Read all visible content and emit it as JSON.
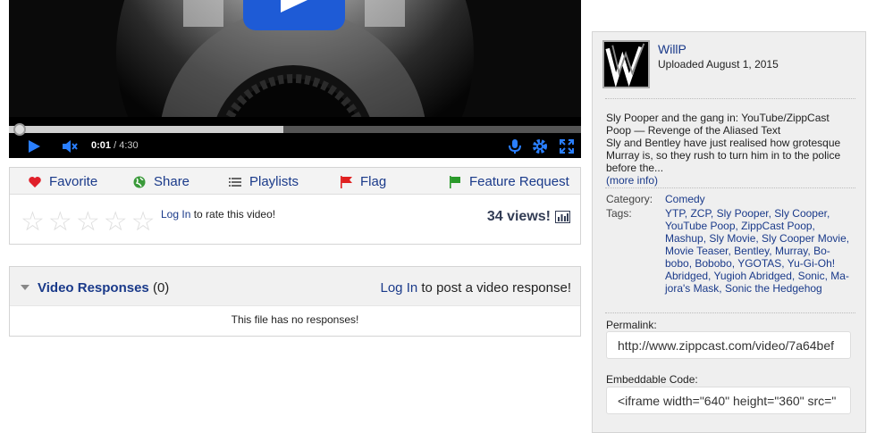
{
  "player": {
    "current_time": "0:01",
    "duration": "4:30",
    "progress_buffered": 0.48,
    "progress_played": 0.004
  },
  "actions": {
    "favorite": "Favorite",
    "share": "Share",
    "playlists": "Playlists",
    "flag": "Flag",
    "feature_request": "Feature Request"
  },
  "rating": {
    "stars": 5,
    "filled": 0,
    "login_link": "Log In",
    "login_suffix": " to rate this video!",
    "views": "34 views!"
  },
  "responses": {
    "title": "Video Responses",
    "count": "(0)",
    "login_link": "Log In",
    "login_suffix": " to post a video response!",
    "empty": "This file has no responses!"
  },
  "uploader": {
    "name": "WillP",
    "uploaded": "Uploaded August 1, 2015"
  },
  "description": {
    "line1": "Sly Pooper and the gang in: YouTube/ZippCast Poop — Revenge of the Aliased Text",
    "line2": "Sly and Bentley have just realised how grotesque Murray is, so they rush to turn him in to the police before the...",
    "more": "(more info)"
  },
  "meta": {
    "category_label": "Category:",
    "category": "Comedy",
    "tags_label": "Tags:",
    "tags": "YTP, ZCP, Sly Pooper, Sly Cooper, YouTube Poop, ZippCast Poop, Mashup, Sly Movie, Sly Cooper Movie, Movie Teaser, Bentley, Murray, Bo-bobo, Bobobo, YGOTAS, Yu-Gi-Oh! Abridged, Yugioh Abridged, Sonic, Ma-jora's Mask, Sonic the Hedgehog"
  },
  "share_fields": {
    "permalink_label": "Permalink:",
    "permalink": "http://www.zippcast.com/video/7a64bef",
    "embed_label": "Embeddable Code:",
    "embed": "<iframe width=\"640\" height=\"360\" src=\""
  },
  "colors": {
    "link": "#1a3a8a",
    "play_blue": "#1e5bd6",
    "heart": "#e0202a",
    "share_green": "#3a9a3a",
    "flag_red": "#e02020",
    "feature_green": "#2a9a2a"
  }
}
